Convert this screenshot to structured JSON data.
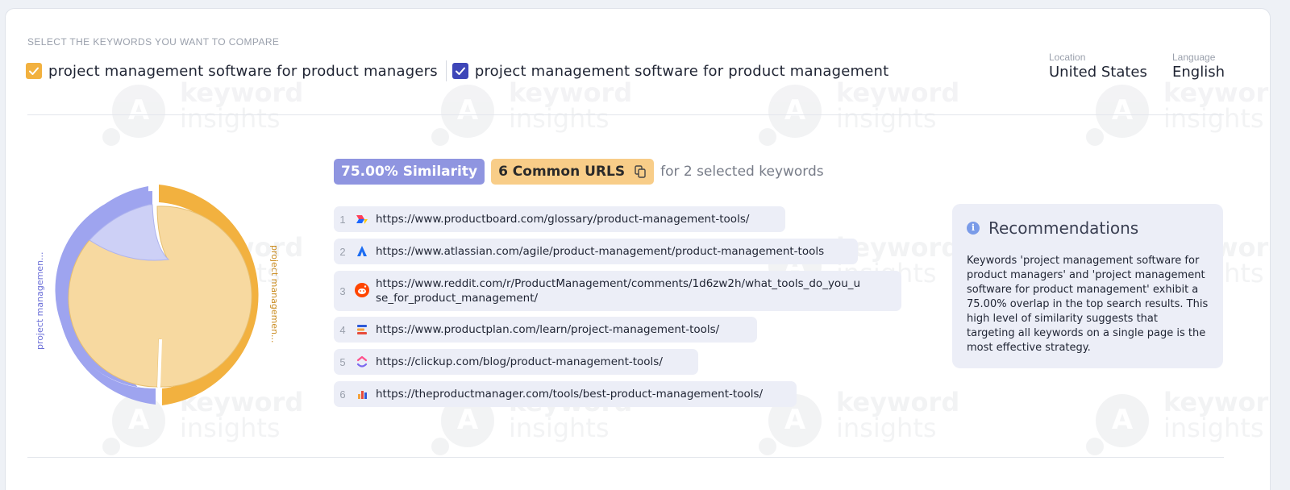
{
  "header": {
    "select_label": "SELECT THE KEYWORDS YOU WANT TO COMPARE",
    "keywords": [
      {
        "label": "project management software for product managers",
        "checked": true,
        "color": "#f2b13f"
      },
      {
        "label": "project management software for product management",
        "checked": true,
        "color": "#3e46b8"
      }
    ],
    "location_label": "Location",
    "location_value": "United States",
    "language_label": "Language",
    "language_value": "English"
  },
  "watermark": {
    "word1": "keyword",
    "word2": "insights"
  },
  "chart": {
    "left_label": "project managemen...",
    "right_label": "project managemen...",
    "colors": {
      "blue": "#9ea4ef",
      "orange": "#f2b13f",
      "orange_fill": "#f7d9a0",
      "blue_fill": "#cdd0f6"
    }
  },
  "summary": {
    "similarity": "75.00% Similarity",
    "common_urls": "6 Common URLS",
    "suffix": "for 2 selected keywords"
  },
  "urls": [
    {
      "num": "1",
      "icon": "productboard-icon",
      "url": "https://www.productboard.com/glossary/product-management-tools/"
    },
    {
      "num": "2",
      "icon": "atlassian-icon",
      "url": "https://www.atlassian.com/agile/product-management/product-management-tools"
    },
    {
      "num": "3",
      "icon": "reddit-icon",
      "url": "https://www.reddit.com/r/ProductManagement/comments/1d6zw2h/what_tools_do_you_u",
      "url2": "se_for_product_management/"
    },
    {
      "num": "4",
      "icon": "productplan-icon",
      "url": "https://www.productplan.com/learn/project-management-tools/"
    },
    {
      "num": "5",
      "icon": "clickup-icon",
      "url": "https://clickup.com/blog/product-management-tools/"
    },
    {
      "num": "6",
      "icon": "theproductmanager-icon",
      "url": "https://theproductmanager.com/tools/best-product-management-tools/"
    }
  ],
  "recommendations": {
    "title": "Recommendations",
    "body": "Keywords 'project management software for product managers' and 'project management software for product management' exhibit a 75.00% overlap in the top search results. This high level of similarity suggests that targeting all keywords on a single page is the most effective strategy."
  }
}
